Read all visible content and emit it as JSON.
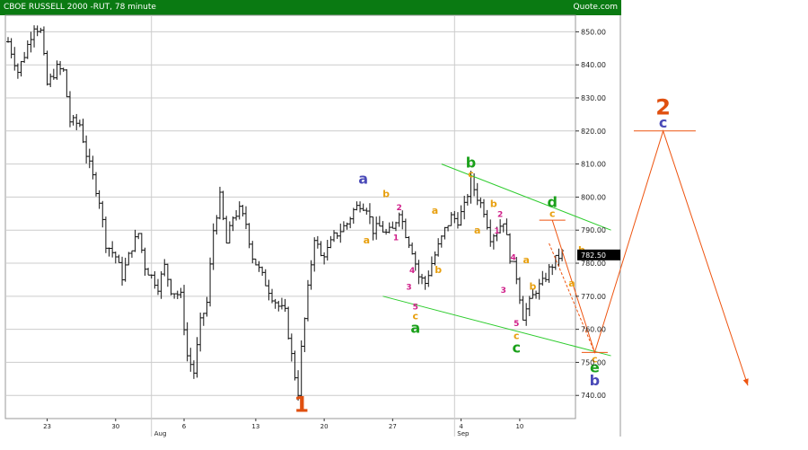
{
  "header": {
    "title": "CBOE RUSSELL 2000 -RUT, 78 minute",
    "source": "Quote.com"
  },
  "colors": {
    "header_bg": "#0a7a12",
    "bars": "#111111",
    "grid": "#cccccc",
    "channel": "#2ecc2e",
    "projection": "#ee5511",
    "label_blue": "#4a4ab8",
    "label_green": "#1aa01a",
    "label_orange": "#e8a010",
    "label_magenta": "#d0208a",
    "label_red": "#e05010"
  },
  "chart_data": {
    "type": "bar",
    "title": "CBOE RUSSELL 2000 -RUT, 78 minute",
    "ylim": [
      733,
      855
    ],
    "ytick_values": [
      740,
      750,
      760,
      770,
      780,
      790,
      800,
      810,
      820,
      830,
      840,
      850
    ],
    "ytick_labels": [
      "740.00",
      "750.00",
      "760.00",
      "770.00",
      "780.00",
      "790.00",
      "800.00",
      "810.00",
      "820.00",
      "830.00",
      "840.00",
      "850.00"
    ],
    "x_day_labels": [
      {
        "label": "23",
        "bar": 12
      },
      {
        "label": "30",
        "bar": 33
      },
      {
        "label": "6",
        "bar": 54
      },
      {
        "label": "13",
        "bar": 76
      },
      {
        "label": "20",
        "bar": 97
      },
      {
        "label": "27",
        "bar": 118
      },
      {
        "label": "4",
        "bar": 139
      },
      {
        "label": "10",
        "bar": 157
      }
    ],
    "x_month_labels": [
      {
        "label": "Aug",
        "bar": 44
      },
      {
        "label": "Sep",
        "bar": 137
      }
    ],
    "anchors": [
      [
        0,
        847
      ],
      [
        3,
        838
      ],
      [
        5,
        843
      ],
      [
        8,
        852
      ],
      [
        10,
        850
      ],
      [
        12,
        834
      ],
      [
        15,
        839
      ],
      [
        17,
        838
      ],
      [
        19,
        823
      ],
      [
        22,
        822
      ],
      [
        24,
        813
      ],
      [
        26,
        806
      ],
      [
        28,
        799
      ],
      [
        30,
        786
      ],
      [
        33,
        782
      ],
      [
        35,
        776
      ],
      [
        38,
        785
      ],
      [
        40,
        789
      ],
      [
        42,
        779
      ],
      [
        44,
        776
      ],
      [
        46,
        773
      ],
      [
        48,
        779
      ],
      [
        50,
        772
      ],
      [
        53,
        770
      ],
      [
        55,
        752
      ],
      [
        57,
        747
      ],
      [
        59,
        762
      ],
      [
        61,
        768
      ],
      [
        63,
        790
      ],
      [
        65,
        800
      ],
      [
        67,
        786
      ],
      [
        69,
        794
      ],
      [
        71,
        796
      ],
      [
        73,
        792
      ],
      [
        75,
        782
      ],
      [
        77,
        778
      ],
      [
        79,
        774
      ],
      [
        81,
        770
      ],
      [
        83,
        767
      ],
      [
        85,
        765
      ],
      [
        87,
        752
      ],
      [
        88,
        746
      ],
      [
        89,
        741
      ],
      [
        90,
        754
      ],
      [
        92,
        772
      ],
      [
        94,
        788
      ],
      [
        96,
        782
      ],
      [
        98,
        784
      ],
      [
        100,
        788
      ],
      [
        102,
        790
      ],
      [
        104,
        792
      ],
      [
        106,
        796
      ],
      [
        108,
        798
      ],
      [
        110,
        797
      ],
      [
        112,
        790
      ],
      [
        114,
        791
      ],
      [
        116,
        789
      ],
      [
        118,
        790
      ],
      [
        120,
        796
      ],
      [
        122,
        789
      ],
      [
        124,
        784
      ],
      [
        126,
        776
      ],
      [
        128,
        774
      ],
      [
        130,
        780
      ],
      [
        132,
        785
      ],
      [
        134,
        790
      ],
      [
        136,
        794
      ],
      [
        138,
        793
      ],
      [
        140,
        797
      ],
      [
        142,
        805
      ],
      [
        144,
        800
      ],
      [
        146,
        796
      ],
      [
        148,
        788
      ],
      [
        150,
        790
      ],
      [
        152,
        793
      ],
      [
        154,
        782
      ],
      [
        156,
        776
      ],
      [
        158,
        764
      ],
      [
        160,
        768
      ],
      [
        162,
        772
      ],
      [
        164,
        774
      ],
      [
        166,
        778
      ],
      [
        168,
        781
      ],
      [
        170,
        783
      ]
    ],
    "last_price": "782.50",
    "annotations": [
      {
        "text": "1",
        "bar": 90,
        "y": 735,
        "color": "red",
        "size": "big"
      },
      {
        "text": "a",
        "bar": 109,
        "y": 804,
        "color": "blue",
        "size": "mid"
      },
      {
        "text": "a",
        "bar": 110,
        "y": 786,
        "color": "orange",
        "size": "small"
      },
      {
        "text": "b",
        "bar": 116,
        "y": 800,
        "color": "orange",
        "size": "small"
      },
      {
        "text": "2",
        "bar": 120,
        "y": 796,
        "color": "magenta",
        "size": "tiny"
      },
      {
        "text": "1",
        "bar": 119,
        "y": 787,
        "color": "magenta",
        "size": "tiny"
      },
      {
        "text": "3",
        "bar": 123,
        "y": 772,
        "color": "magenta",
        "size": "tiny"
      },
      {
        "text": "4",
        "bar": 124,
        "y": 777,
        "color": "magenta",
        "size": "tiny"
      },
      {
        "text": "5",
        "bar": 125,
        "y": 766,
        "color": "magenta",
        "size": "tiny"
      },
      {
        "text": "c",
        "bar": 125,
        "y": 763,
        "color": "orange",
        "size": "small"
      },
      {
        "text": "a",
        "bar": 125,
        "y": 759,
        "color": "green",
        "size": "mid"
      },
      {
        "text": "b",
        "bar": 132,
        "y": 777,
        "color": "orange",
        "size": "small"
      },
      {
        "text": "a",
        "bar": 131,
        "y": 795,
        "color": "orange",
        "size": "small"
      },
      {
        "text": "b",
        "bar": 142,
        "y": 809,
        "color": "green",
        "size": "mid"
      },
      {
        "text": "c",
        "bar": 142,
        "y": 806,
        "color": "orange",
        "size": "small"
      },
      {
        "text": "a",
        "bar": 144,
        "y": 789,
        "color": "orange",
        "size": "small"
      },
      {
        "text": "b",
        "bar": 149,
        "y": 797,
        "color": "orange",
        "size": "small"
      },
      {
        "text": "2",
        "bar": 151,
        "y": 794,
        "color": "magenta",
        "size": "tiny"
      },
      {
        "text": "1",
        "bar": 150,
        "y": 789,
        "color": "magenta",
        "size": "tiny"
      },
      {
        "text": "4",
        "bar": 155,
        "y": 781,
        "color": "magenta",
        "size": "tiny"
      },
      {
        "text": "3",
        "bar": 152,
        "y": 771,
        "color": "magenta",
        "size": "tiny"
      },
      {
        "text": "5",
        "bar": 156,
        "y": 761,
        "color": "magenta",
        "size": "tiny"
      },
      {
        "text": "c",
        "bar": 156,
        "y": 757,
        "color": "orange",
        "size": "small"
      },
      {
        "text": "c",
        "bar": 156,
        "y": 753,
        "color": "green",
        "size": "mid"
      },
      {
        "text": "a",
        "bar": 159,
        "y": 780,
        "color": "orange",
        "size": "small"
      },
      {
        "text": "b",
        "bar": 161,
        "y": 772,
        "color": "orange",
        "size": "small"
      },
      {
        "text": "d",
        "bar": 167,
        "y": 797,
        "color": "green",
        "size": "mid"
      },
      {
        "text": "c",
        "bar": 167,
        "y": 794,
        "color": "orange",
        "size": "small"
      },
      {
        "text": "b",
        "bar": 176,
        "y": 783,
        "color": "orange",
        "size": "small"
      },
      {
        "text": "a",
        "bar": 173,
        "y": 773,
        "color": "orange",
        "size": "small"
      }
    ],
    "projection_labels": [
      {
        "text": "c",
        "bar": 180,
        "y": 750,
        "color": "orange",
        "size": "small"
      },
      {
        "text": "e",
        "bar": 180,
        "y": 747,
        "color": "green",
        "size": "mid"
      },
      {
        "text": "b",
        "bar": 180,
        "y": 743,
        "color": "blue",
        "size": "mid"
      },
      {
        "text": "2",
        "bar": 201,
        "y": 825,
        "color": "red",
        "size": "big"
      },
      {
        "text": "c",
        "bar": 201,
        "y": 821,
        "color": "blue",
        "size": "mid"
      }
    ],
    "channels": [
      {
        "from": [
          133,
          810
        ],
        "to": [
          185,
          790
        ]
      },
      {
        "from": [
          115,
          770
        ],
        "to": [
          185,
          752
        ]
      }
    ],
    "projection_path": [
      [
        167,
        793
      ],
      [
        180,
        753
      ],
      [
        201,
        820
      ],
      [
        227,
        743
      ]
    ],
    "projection_dashed": [
      [
        166,
        786
      ],
      [
        180,
        753
      ]
    ],
    "horizontal_marks": [
      {
        "bar_from": 163,
        "bar_to": 171,
        "y": 793
      },
      {
        "bar_from": 176,
        "bar_to": 184,
        "y": 753
      },
      {
        "bar_from": 192,
        "bar_to": 211,
        "y": 820
      }
    ]
  }
}
